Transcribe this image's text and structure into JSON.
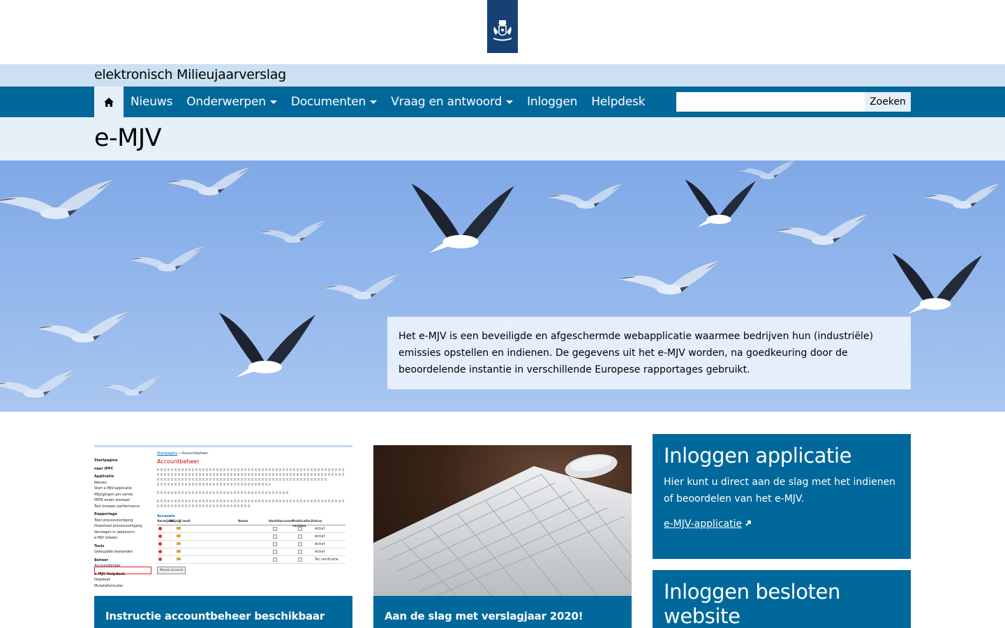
{
  "header": {
    "site_title": "elektronisch Milieujaarverslag"
  },
  "nav": {
    "home_icon": "home-icon",
    "items": [
      {
        "label": "Nieuws",
        "dropdown": false
      },
      {
        "label": "Onderwerpen",
        "dropdown": true
      },
      {
        "label": "Documenten",
        "dropdown": true
      },
      {
        "label": "Vraag en antwoord",
        "dropdown": true
      },
      {
        "label": "Inloggen",
        "dropdown": false
      },
      {
        "label": "Helpdesk",
        "dropdown": false
      }
    ],
    "search": {
      "value": "",
      "button_label": "Zoeken"
    }
  },
  "page": {
    "title": "e-MJV"
  },
  "hero": {
    "text": "Het e-MJV is een beveiligde en afgeschermde webapplicatie waarmee bedrijven hun (industriële) emissies opstellen en indienen. De gegevens uit het e-MJV worden, na goedkeuring door de beoordelende instantie in verschillende Europese rapportages gebruikt."
  },
  "cards": [
    {
      "caption": "Instructie accountbeheer beschikbaar",
      "thumbnail": {
        "breadcrumb_home": "Startpagina",
        "breadcrumb_current": "Accountbeheer",
        "heading": "Accountbeheer",
        "sidebar": [
          "Startpagina",
          "naar IPPC",
          "Applicatie",
          "Nieuws",
          "Start e-MJV-applicatie",
          "Wijzigingen per versie",
          "PRTR onder drempel",
          "Test browser performance",
          "Rapportage",
          "Toon procesvoortgang",
          "Download procesvoortgang",
          "Verslagen in tabelvorm",
          "e-MJV totalen",
          "Tools",
          "Geleupdde bestanden",
          "Beheer",
          "Accountbeheer",
          "e-MJV-Helpdesk",
          "Helpdesk",
          "Mutatieformulier"
        ],
        "section": "Accounts",
        "columns": [
          "Verwijder",
          "Wijzig",
          "E-mail",
          "Naam",
          "Hoofdaccount",
          "Publicatie rechten",
          "Status"
        ],
        "statuses": [
          "Actief",
          "Actief",
          "Actief",
          "Actief",
          "Ter verificatie"
        ],
        "new_account_label": "Nieuw account"
      }
    },
    {
      "caption": "Aan de slag met verslagjaar 2020!"
    }
  ],
  "tiles": [
    {
      "title": "Inloggen applicatie",
      "text": "Hier kunt u direct aan de slag met het indienen of beoordelen van het e-MJV.",
      "link": "e-MJV-applicatie"
    },
    {
      "title": "Inloggen besloten website"
    }
  ],
  "colors": {
    "brand_dark": "#154273",
    "nav_blue": "#01689b",
    "light_band": "#cce0f1",
    "lighter_band": "#e5f0f9"
  }
}
